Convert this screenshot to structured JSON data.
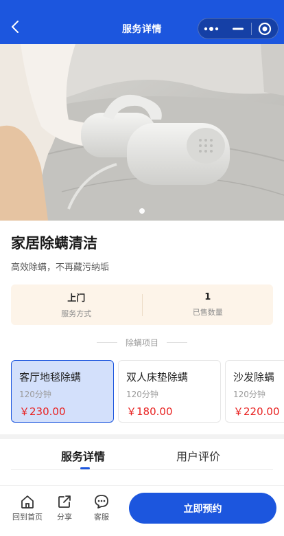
{
  "navbar": {
    "title": "服务详情"
  },
  "service": {
    "title": "家居除螨清洁",
    "subtitle": "高效除螨，不再藏污纳垢"
  },
  "info": [
    {
      "value": "上门",
      "label": "服务方式"
    },
    {
      "value": "1",
      "label": "已售数量"
    }
  ],
  "section_label": "除螨项目",
  "items": [
    {
      "name": "客厅地毯除螨",
      "duration": "120分钟",
      "price": "￥230.00",
      "selected": true
    },
    {
      "name": "双人床垫除螨",
      "duration": "120分钟",
      "price": "￥180.00",
      "selected": false
    },
    {
      "name": "沙发除螨",
      "duration": "120分钟",
      "price": "￥220.00",
      "selected": false
    }
  ],
  "tabs": [
    {
      "label": "服务详情",
      "active": true
    },
    {
      "label": "用户评价",
      "active": false
    }
  ],
  "bottom": {
    "home": "回到首页",
    "share": "分享",
    "service": "客服",
    "book": "立即预约"
  },
  "colors": {
    "brand": "#1c56de",
    "price": "#e8201f",
    "info_bg": "#fdf4e9",
    "selected_card_bg": "#d3e0fb"
  },
  "icons": [
    "back-icon",
    "more-icon",
    "minimize-icon",
    "target-icon",
    "home-icon",
    "share-icon",
    "chat-icon"
  ]
}
